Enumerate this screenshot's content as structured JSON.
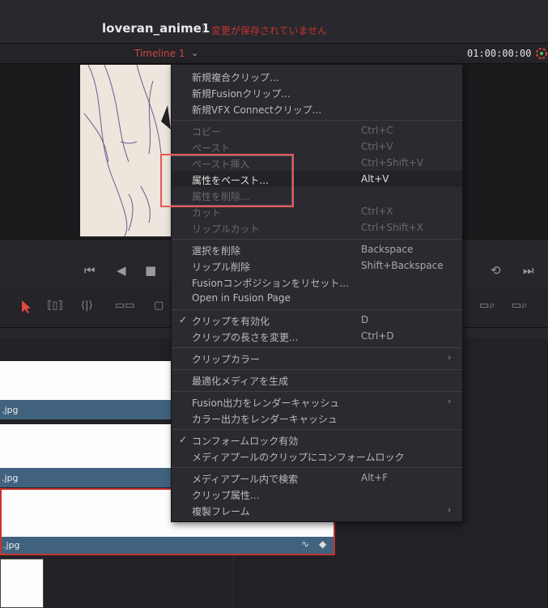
{
  "header": {
    "project_name": "loveran_anime1",
    "unsaved_status": "変更が保存されていません"
  },
  "viewer": {
    "timeline_name": "Timeline 1",
    "timecode": "01:00:00:00"
  },
  "context_menu": {
    "group1": [
      {
        "label": "新規複合クリップ..."
      },
      {
        "label": "新規Fusionクリップ..."
      },
      {
        "label": "新規VFX Connectクリップ..."
      }
    ],
    "group2": [
      {
        "label": "コピー",
        "shortcut": "Ctrl+C",
        "enabled": false
      },
      {
        "label": "ペースト",
        "shortcut": "Ctrl+V",
        "enabled": false
      },
      {
        "label": "ペースト挿入",
        "shortcut": "Ctrl+Shift+V",
        "enabled": false
      },
      {
        "label": "属性をペースト...",
        "shortcut": "Alt+V",
        "enabled": true
      },
      {
        "label": "属性を削除...",
        "shortcut": "",
        "enabled": false
      },
      {
        "label": "カット",
        "shortcut": "Ctrl+X",
        "enabled": false
      },
      {
        "label": "リップルカット",
        "shortcut": "Ctrl+Shift+X",
        "enabled": false
      }
    ],
    "group3": [
      {
        "label": "選択を削除",
        "shortcut": "Backspace"
      },
      {
        "label": "リップル削除",
        "shortcut": "Shift+Backspace"
      },
      {
        "label": "Fusionコンポジションをリセット...",
        "shortcut": ""
      },
      {
        "label": "Open in Fusion Page",
        "shortcut": ""
      }
    ],
    "group4": [
      {
        "label": "クリップを有効化",
        "shortcut": "D",
        "checked": true
      },
      {
        "label": "クリップの長さを変更...",
        "shortcut": "Ctrl+D"
      }
    ],
    "group5": [
      {
        "label": "クリップカラー",
        "submenu": true
      }
    ],
    "group6": [
      {
        "label": "最適化メディアを生成"
      }
    ],
    "group7": [
      {
        "label": "Fusion出力をレンダーキャッシュ",
        "submenu": true
      },
      {
        "label": "カラー出力をレンダーキャッシュ"
      }
    ],
    "group8": [
      {
        "label": "コンフォームロック有効",
        "checked": true
      },
      {
        "label": "メディアプールのクリップにコンフォームロック"
      }
    ],
    "group9": [
      {
        "label": "メディアプール内で検索",
        "shortcut": "Alt+F"
      },
      {
        "label": "クリップ属性..."
      },
      {
        "label": "複製フレーム",
        "submenu": true
      }
    ]
  },
  "timeline": {
    "clip_labels": [
      ".jpg",
      ".jpg",
      ".jpg"
    ]
  },
  "colors": {
    "accent_red": "#d2473d",
    "clip_blue": "#40627e",
    "menu_bg": "#2a2a30"
  }
}
